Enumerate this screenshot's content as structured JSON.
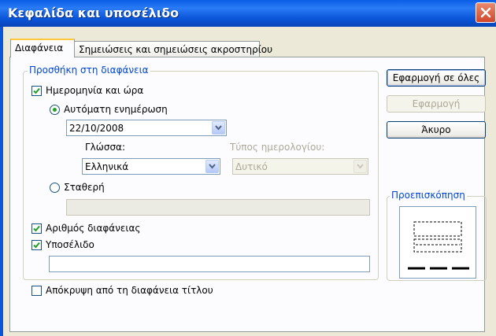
{
  "window": {
    "title": "Κεφαλίδα και υποσέλιδο"
  },
  "tabs": [
    {
      "label": "Διαφάνεια",
      "active": true
    },
    {
      "label": "Σημειώσεις και σημειώσεις ακροστηρίου",
      "active": false
    }
  ],
  "include_group": {
    "label": "Προσθήκη στη διαφάνεια",
    "date_time": {
      "label": "Ημερομηνία και ώρα",
      "checked": true,
      "auto_update": {
        "label": "Αυτόματη ενημέρωση",
        "selected": true,
        "date_value": "22/10/2008",
        "language_label": "Γλώσσα:",
        "language_value": "Ελληνικά",
        "calendar_label": "Τύπος ημερολογίου:",
        "calendar_value": "Δυτικό"
      },
      "fixed": {
        "label": "Σταθερή",
        "selected": false,
        "value": ""
      }
    },
    "slide_number": {
      "label": "Αριθμός διαφάνειας",
      "checked": true
    },
    "footer": {
      "label": "Υποσέλιδο",
      "checked": true,
      "value": ""
    }
  },
  "dont_show_title": {
    "label": "Απόκρυψη από τη διαφάνεια τίτλου",
    "checked": false
  },
  "buttons": {
    "apply_all": "Εφαρμογή σε όλες",
    "apply": "Εφαρμογή",
    "cancel": "Άκυρο"
  },
  "preview": {
    "label": "Προεπισκόπηση"
  },
  "icons": {
    "close": "close-icon",
    "check": "check-icon",
    "dropdown": "chevron-down-icon"
  },
  "colors": {
    "titlebar": "#0a55d8",
    "group_label": "#0046d5",
    "check": "#21a121",
    "tab_highlight": "#ffc83c"
  }
}
